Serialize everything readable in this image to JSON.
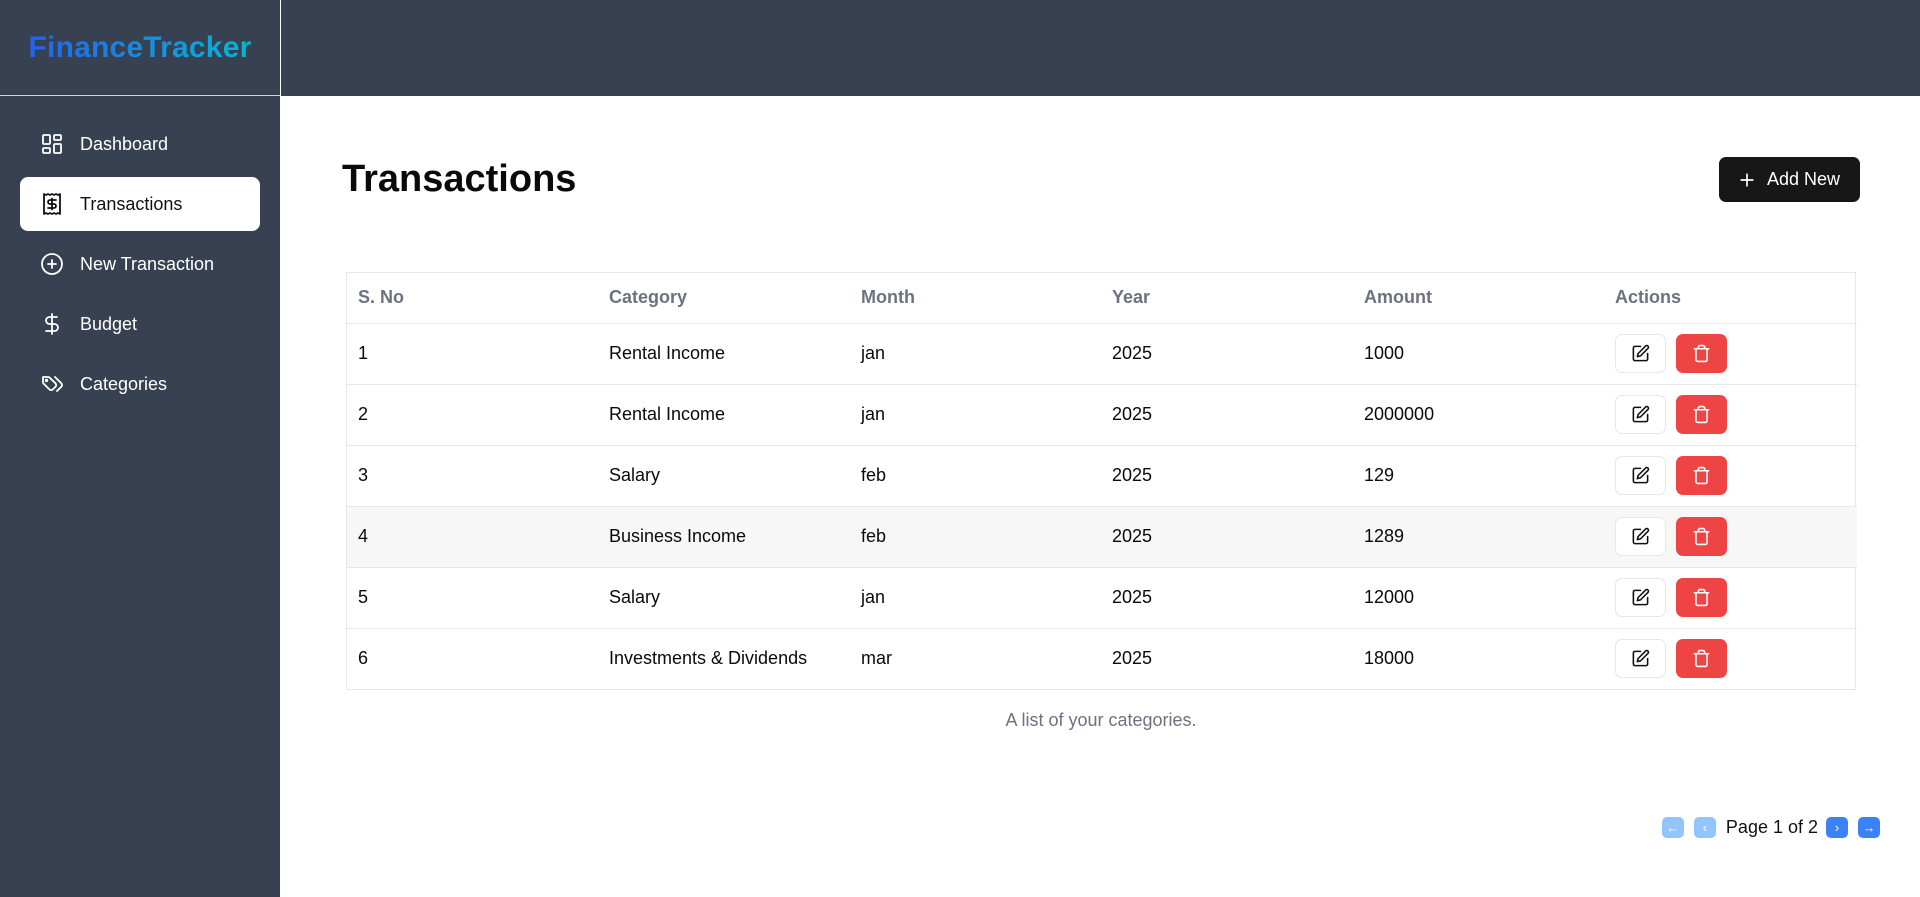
{
  "brand": "FinanceTracker",
  "sidebar": {
    "items": [
      {
        "label": "Dashboard",
        "icon": "dashboard-grid-icon"
      },
      {
        "label": "Transactions",
        "icon": "receipt-dollar-icon",
        "active": true
      },
      {
        "label": "New Transaction",
        "icon": "plus-circle-icon"
      },
      {
        "label": "Budget",
        "icon": "dollar-sign-icon"
      },
      {
        "label": "Categories",
        "icon": "tags-icon"
      }
    ]
  },
  "page": {
    "title": "Transactions",
    "add_label": "Add New"
  },
  "table": {
    "columns": [
      "S. No",
      "Category",
      "Month",
      "Year",
      "Amount",
      "Actions"
    ],
    "rows": [
      {
        "sno": "1",
        "category": "Rental Income",
        "month": "jan",
        "year": "2025",
        "amount": "1000"
      },
      {
        "sno": "2",
        "category": "Rental Income",
        "month": "jan",
        "year": "2025",
        "amount": "2000000"
      },
      {
        "sno": "3",
        "category": "Salary",
        "month": "feb",
        "year": "2025",
        "amount": "129"
      },
      {
        "sno": "4",
        "category": "Business Income",
        "month": "feb",
        "year": "2025",
        "amount": "1289"
      },
      {
        "sno": "5",
        "category": "Salary",
        "month": "jan",
        "year": "2025",
        "amount": "12000"
      },
      {
        "sno": "6",
        "category": "Investments & Dividends",
        "month": "mar",
        "year": "2025",
        "amount": "18000"
      }
    ],
    "caption": "A list of your categories."
  },
  "pagination": {
    "text": "Page 1 of 2",
    "first": "←",
    "prev": "‹",
    "next": "›",
    "last": "→"
  },
  "colors": {
    "sidebar_bg": "#374151",
    "brand_gradient_start": "#2563eb",
    "brand_gradient_end": "#06b6d4",
    "delete_red": "#ef4444",
    "page_btn_enabled": "#3b82f6",
    "page_btn_disabled": "#93c5fd"
  }
}
